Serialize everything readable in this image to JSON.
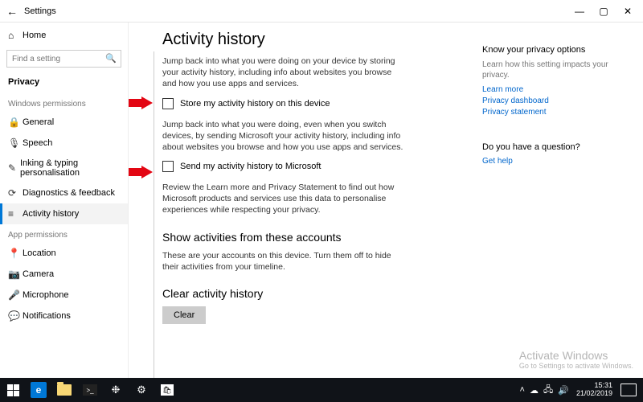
{
  "titlebar": {
    "back_icon": "←",
    "title": "Settings",
    "min": "—",
    "max": "▢",
    "close": "✕"
  },
  "sidebar": {
    "home_label": "Home",
    "search_placeholder": "Find a setting",
    "category": "Privacy",
    "section1": "Windows permissions",
    "section2": "App permissions",
    "items1": [
      {
        "icon": "🔒",
        "label": "General"
      },
      {
        "icon": "🎙",
        "label": "Speech"
      },
      {
        "icon": "✎",
        "label": "Inking & typing personalisation"
      },
      {
        "icon": "⟳",
        "label": "Diagnostics & feedback"
      },
      {
        "icon": "≡",
        "label": "Activity history",
        "active": true
      }
    ],
    "items2": [
      {
        "icon": "📍",
        "label": "Location"
      },
      {
        "icon": "📷",
        "label": "Camera"
      },
      {
        "icon": "🎤",
        "label": "Microphone"
      },
      {
        "icon": "💬",
        "label": "Notifications"
      }
    ]
  },
  "content": {
    "heading": "Activity history",
    "p1": "Jump back into what you were doing on your device by storing your activity history, including info about websites you browse and how you use apps and services.",
    "check1": "Store my activity history on this device",
    "p2": "Jump back into what you were doing, even when you switch devices, by sending Microsoft your activity history, including info about websites you browse and how you use apps and services.",
    "check2": "Send my activity history to Microsoft",
    "p3": "Review the Learn more and Privacy Statement to find out how Microsoft products and services use this data to personalise experiences while respecting your privacy.",
    "h2a": "Show activities from these accounts",
    "p4": "These are your accounts on this device. Turn them off to hide their activities from your timeline.",
    "h2b": "Clear activity history",
    "clear_btn": "Clear"
  },
  "right": {
    "h1": "Know your privacy options",
    "hint": "Learn how this setting impacts your privacy.",
    "links": [
      "Learn more",
      "Privacy dashboard",
      "Privacy statement"
    ],
    "h2": "Do you have a question?",
    "help_link": "Get help"
  },
  "watermark": {
    "l1": "Activate Windows",
    "l2": "Go to Settings to activate Windows."
  },
  "taskbar": {
    "time": "15:31",
    "date": "21/02/2019"
  }
}
